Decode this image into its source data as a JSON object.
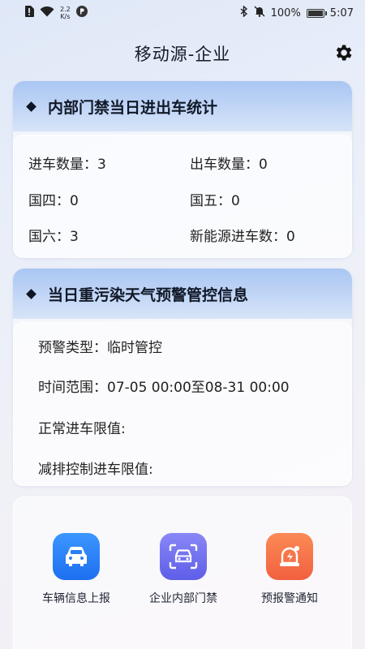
{
  "status_bar": {
    "net_speed_value": "2.2",
    "net_speed_unit": "K/s",
    "battery_percent": "100%",
    "time": "5:07"
  },
  "header": {
    "title": "移动源-企业",
    "settings_icon": "gear-icon"
  },
  "gate_stats": {
    "title": "内部门禁当日进出车统计",
    "rows": [
      {
        "left": "进车数量：3",
        "right": "出车数量：0"
      },
      {
        "left": "国四：0",
        "right": "国五：0"
      },
      {
        "left": "国六：3",
        "right": "新能源进车数：0"
      }
    ]
  },
  "warning": {
    "title": "当日重污染天气预警管控信息",
    "type": "预警类型：临时管控",
    "time_range": "时间范围：07-05 00:00至08-31 00:00",
    "normal_limit": "正常进车限值:",
    "reduced_limit": "减排控制进车限值:"
  },
  "nav": {
    "items": [
      {
        "label": "车辆信息上报",
        "icon": "car-icon",
        "color": "#2b7ff5"
      },
      {
        "label": "企业内部门禁",
        "icon": "car-scan-icon",
        "color": "#6d6ef2"
      },
      {
        "label": "预报警通知",
        "icon": "alarm-bell-icon",
        "color": "#f4704b"
      }
    ]
  }
}
